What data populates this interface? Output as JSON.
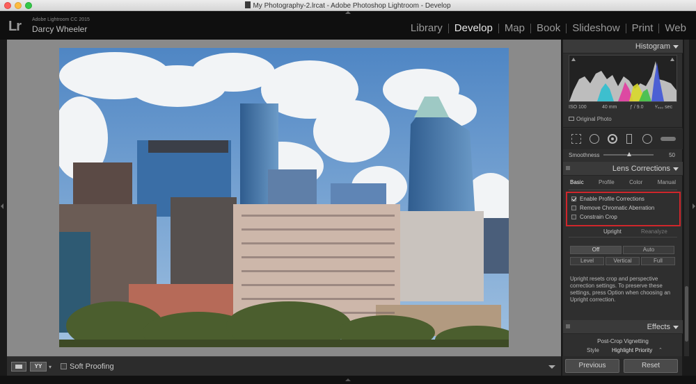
{
  "window": {
    "title": "My Photography-2.lrcat - Adobe Photoshop Lightroom - Develop"
  },
  "identity": {
    "logo": "Lr",
    "app_name": "Adobe Lightroom CC 2015",
    "user_name": "Darcy Wheeler"
  },
  "modules": [
    "Library",
    "Develop",
    "Map",
    "Book",
    "Slideshow",
    "Print",
    "Web"
  ],
  "active_module": "Develop",
  "toolbar": {
    "view_mode": "YY",
    "soft_proofing_label": "Soft Proofing",
    "soft_proofing_checked": false
  },
  "histogram": {
    "title": "Histogram",
    "iso": "ISO 100",
    "focal_length": "40 mm",
    "aperture": "ƒ / 9.0",
    "shutter": "¹⁄₄₀₀ sec",
    "original_photo_label": "Original Photo"
  },
  "smoothness": {
    "label": "Smoothness",
    "value": "50"
  },
  "lens_corrections": {
    "title": "Lens Corrections",
    "tabs": [
      "Basic",
      "Profile",
      "Color",
      "Manual"
    ],
    "active_tab": "Basic",
    "options": [
      {
        "label": "Enable Profile Corrections",
        "checked": true
      },
      {
        "label": "Remove Chromatic Aberration",
        "checked": false
      },
      {
        "label": "Constrain Crop",
        "checked": false
      }
    ],
    "upright_label": "Upright",
    "reanalyze_label": "Reanalyze",
    "upright_buttons_row1": [
      "Off",
      "Auto"
    ],
    "upright_buttons_row2": [
      "Level",
      "Vertical",
      "Full"
    ],
    "info_text": "Upright resets crop and perspective correction settings. To preserve these settings, press Option when choosing an Upright correction."
  },
  "effects": {
    "title": "Effects",
    "vignetting_title": "Post-Crop Vignetting",
    "style_label": "Style",
    "style_value": "Highlight Priority"
  },
  "footer": {
    "previous_label": "Previous",
    "reset_label": "Reset"
  },
  "colors": {
    "highlight_box": "#d0262b",
    "panel_bg": "#2f2f2f",
    "canvas_bg": "#8a8a8a"
  }
}
